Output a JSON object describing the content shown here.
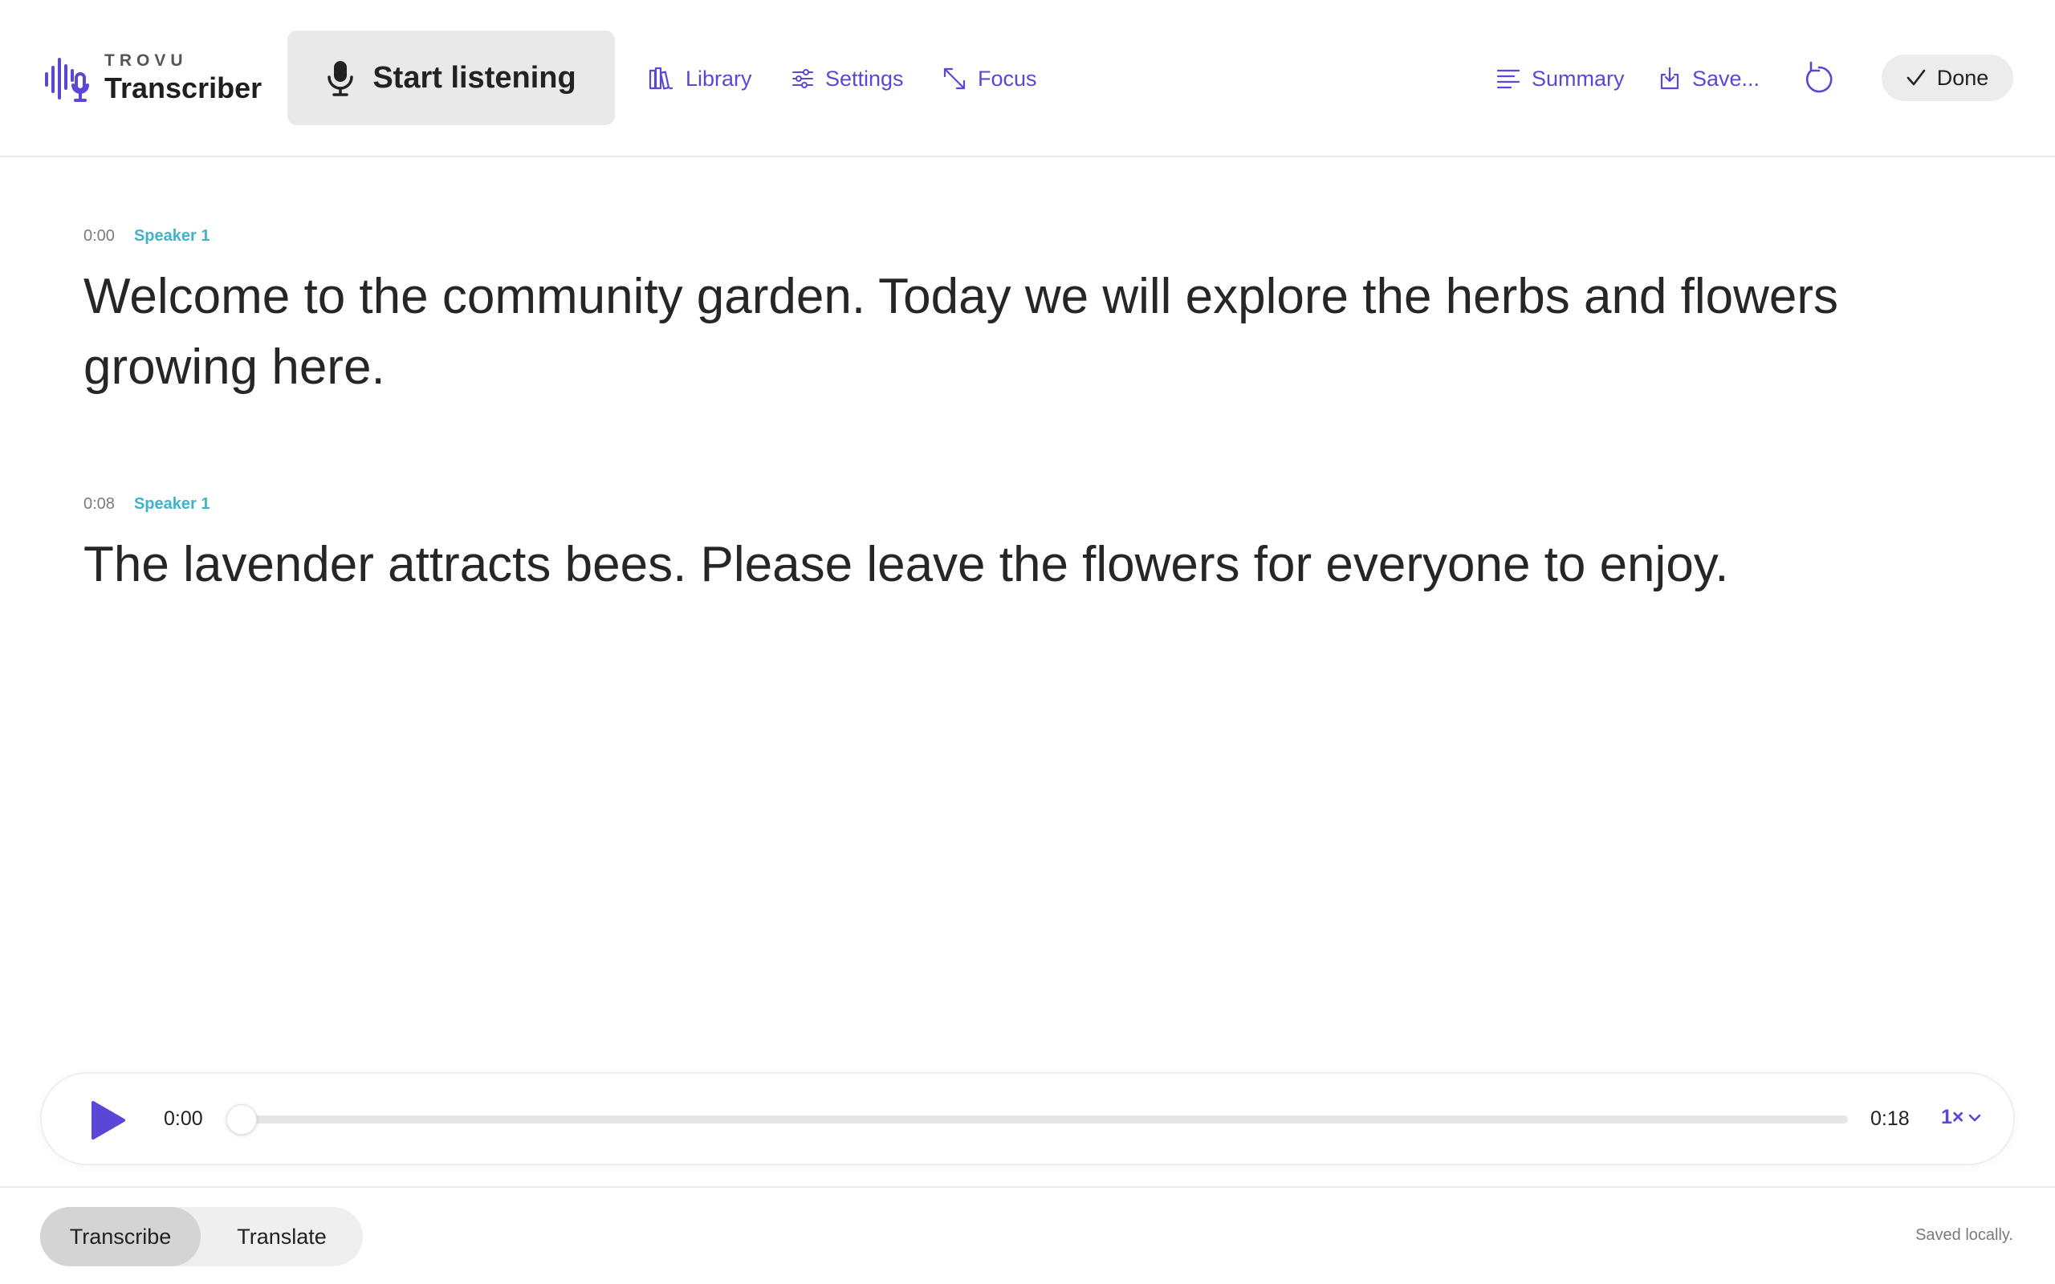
{
  "header": {
    "brand_small": "TROVU",
    "brand_name": "Transcriber",
    "start_label": "Start listening",
    "nav": {
      "library": "Library",
      "settings": "Settings",
      "focus": "Focus",
      "summary": "Summary",
      "save": "Save..."
    },
    "done_label": "Done"
  },
  "transcript": [
    {
      "time": "0:00",
      "speaker": "Speaker 1",
      "text": "Welcome to the community garden. Today we will explore the herbs and flowers growing here."
    },
    {
      "time": "0:08",
      "speaker": "Speaker 1",
      "text": "The lavender attracts bees. Please leave the flowers for everyone to enjoy."
    }
  ],
  "player": {
    "current_time": "0:00",
    "total_time": "0:18",
    "progress": 0,
    "speed": "1×"
  },
  "footer": {
    "modes": [
      "Transcribe",
      "Translate"
    ],
    "active_mode": "Transcribe",
    "status": "Saved locally."
  },
  "colors": {
    "accent": "#5b47d6",
    "speaker": "#3fb3c8"
  }
}
